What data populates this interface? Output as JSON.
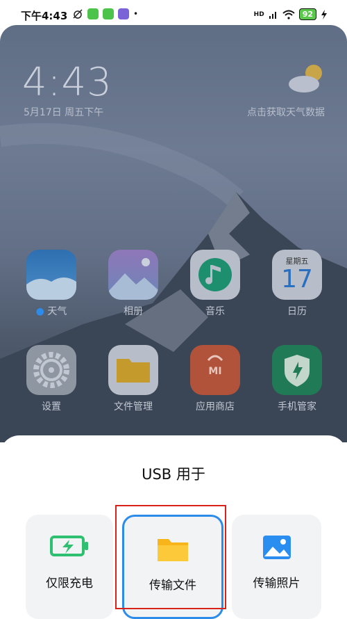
{
  "statusbar": {
    "time": "下午4:43",
    "signal": "HD",
    "battery": "92"
  },
  "lockscreen": {
    "clock": "4:43",
    "date": "5月17日 周五下午",
    "weather_hint": "点击获取天气数据"
  },
  "apps_row1": [
    {
      "label": "天气",
      "icon": "weather-icon",
      "dot": true
    },
    {
      "label": "相册",
      "icon": "gallery-icon"
    },
    {
      "label": "音乐",
      "icon": "music-icon"
    },
    {
      "label": "日历",
      "icon": "calendar-icon",
      "weekday": "星期五",
      "day": "17"
    }
  ],
  "apps_row2": [
    {
      "label": "设置",
      "icon": "settings-icon"
    },
    {
      "label": "文件管理",
      "icon": "folder-icon"
    },
    {
      "label": "应用商店",
      "icon": "app-store-icon",
      "brand": "mi"
    },
    {
      "label": "手机管家",
      "icon": "security-shield-icon"
    }
  ],
  "usb_sheet": {
    "title": "USB 用于",
    "options": [
      {
        "label": "仅限充电",
        "icon": "battery-charge-icon"
      },
      {
        "label": "传输文件",
        "icon": "folder-icon",
        "selected": true
      },
      {
        "label": "传输照片",
        "icon": "photo-icon"
      }
    ]
  },
  "colors": {
    "accent": "#2d8bea",
    "highlight": "#d8231b",
    "charge": "#2fbf71",
    "folder": "#f7b51b",
    "photo": "#2a8ef0"
  }
}
